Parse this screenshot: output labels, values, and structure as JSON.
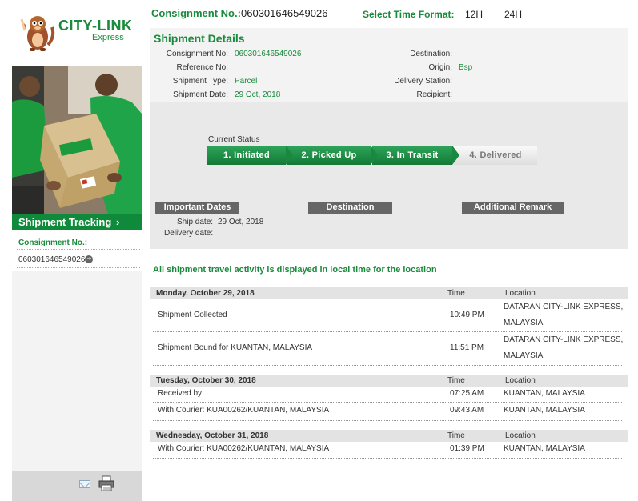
{
  "sidebar": {
    "logo": {
      "brand": "CITY-LINK",
      "sub": "Express"
    },
    "banner": {
      "label": "Shipment Tracking",
      "chevron": "›"
    },
    "consignment_label": "Consignment No.:",
    "consignment_value": "060301646549026",
    "go_icon": "arrow-circle-icon",
    "footer_icons": [
      "mail-icon",
      "print-icon"
    ]
  },
  "topbar": {
    "consignment_label": "Consignment No.:",
    "consignment_value": "060301646549026",
    "time_format_label": "Select Time Format:",
    "format_12": "12H",
    "format_24": "24H"
  },
  "details": {
    "title": "Shipment Details",
    "consignment_label": "Consignment No:",
    "consignment_value": "060301646549026",
    "reference_label": "Reference No:",
    "reference_value": "",
    "type_label": "Shipment Type:",
    "type_value": "Parcel",
    "date_label": "Shipment Date:",
    "date_value": "29 Oct, 2018",
    "destination_label": "Destination:",
    "destination_value": "",
    "origin_label": "Origin:",
    "origin_value": "Bsp",
    "station_label": "Delivery Station:",
    "station_value": "",
    "recipient_label": "Recipient:",
    "recipient_value": ""
  },
  "status": {
    "label": "Current Status",
    "steps": [
      {
        "label": "1. Initiated",
        "done": true
      },
      {
        "label": "2. Picked Up",
        "done": true
      },
      {
        "label": "3. In Transit",
        "done": true
      },
      {
        "label": "4. Delivered",
        "done": false
      }
    ],
    "columns": [
      "Important Dates",
      "Destination",
      "Additional Remark"
    ],
    "ship_date_label": "Ship date:",
    "ship_date_value": "29 Oct, 2018",
    "delivery_date_label": "Delivery date:"
  },
  "activity": {
    "note": "All shipment travel activity is displayed in local time for the location",
    "time_header": "Time",
    "location_header": "Location",
    "days": [
      {
        "date": "Monday, October 29, 2018",
        "events": [
          {
            "desc": "Shipment Collected",
            "time": "10:49 PM",
            "loc1": "DATARAN CITY-LINK EXPRESS,",
            "loc2": "MALAYSIA"
          },
          {
            "desc": "Shipment Bound for KUANTAN, MALAYSIA",
            "time": "11:51 PM",
            "loc1": "DATARAN CITY-LINK EXPRESS,",
            "loc2": "MALAYSIA"
          }
        ]
      },
      {
        "date": "Tuesday, October 30, 2018",
        "events": [
          {
            "desc": "Received by",
            "time": "07:25 AM",
            "loc1": "KUANTAN, MALAYSIA"
          },
          {
            "desc": "With Courier: KUA00262/KUANTAN, MALAYSIA",
            "time": "09:43 AM",
            "loc1": "KUANTAN, MALAYSIA"
          }
        ]
      },
      {
        "date": "Wednesday, October 31, 2018",
        "events": [
          {
            "desc": "With Courier: KUA00262/KUANTAN, MALAYSIA",
            "time": "01:39 PM",
            "loc1": "KUANTAN, MALAYSIA"
          }
        ]
      }
    ]
  }
}
